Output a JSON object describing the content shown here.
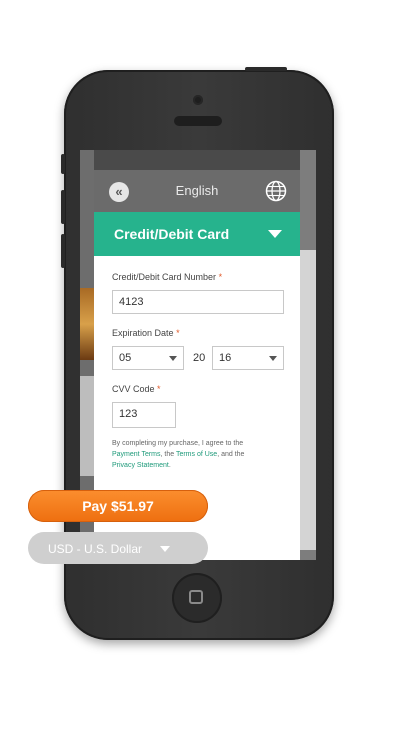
{
  "header": {
    "back_icon": "double-chevron-left-icon",
    "language": "English",
    "globe_icon": "globe-icon"
  },
  "section": {
    "title": "Credit/Debit Card",
    "toggle_icon": "caret-down-icon"
  },
  "form": {
    "card_number": {
      "label": "Credit/Debit Card Number",
      "required_mark": "*",
      "value": "4123"
    },
    "expiration": {
      "label": "Expiration Date",
      "required_mark": "*",
      "month": "05",
      "year_prefix": "20",
      "year": "16"
    },
    "cvv": {
      "label": "CVV Code",
      "required_mark": "*",
      "value": "123"
    }
  },
  "terms": {
    "text_1": "By completing my purchase, I agree to the",
    "link_payment_terms": "Payment Terms",
    "text_2": ", the",
    "link_terms_of_use": "Terms of Use",
    "text_3": ", and the",
    "link_privacy": "Privacy Statement",
    "text_4": "."
  },
  "actions": {
    "pay_label": "Pay $51.97",
    "currency_label": "USD - U.S. Dollar"
  },
  "colors": {
    "accent_green": "#26b38d",
    "pay_orange": "#f47c20",
    "header_gray": "#6b6b6b"
  }
}
